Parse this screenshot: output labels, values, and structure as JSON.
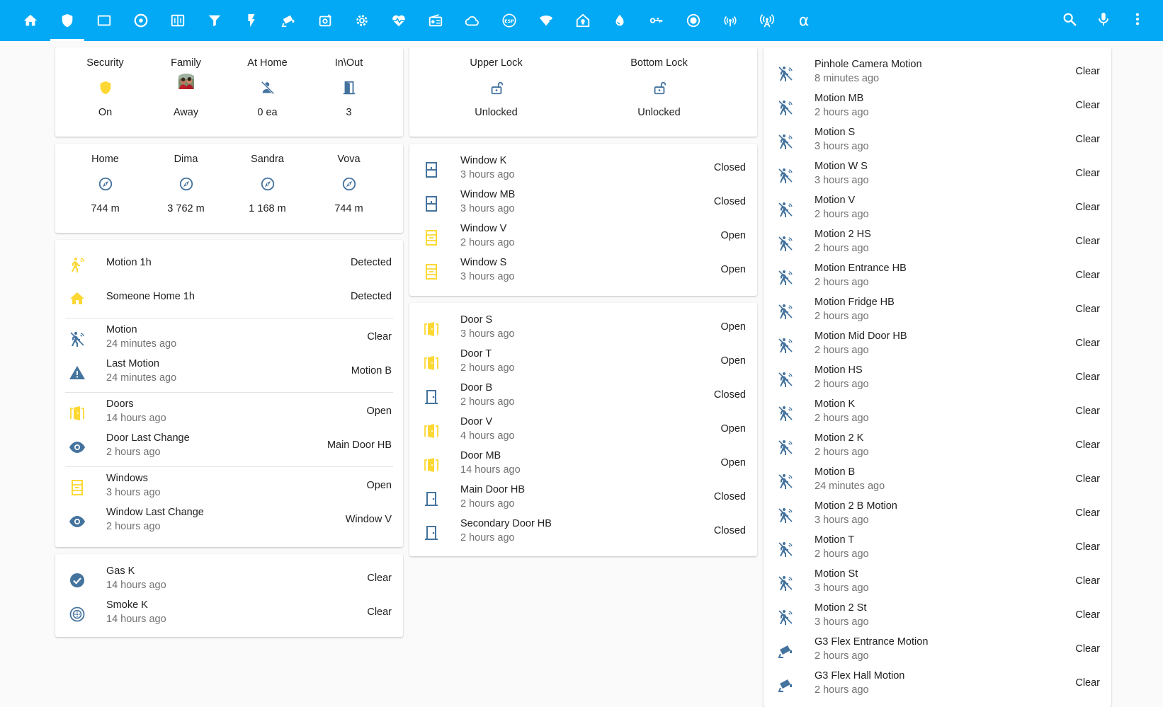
{
  "colors": {
    "header": "#03a9f4",
    "icon_blue": "#44739e",
    "icon_yellow": "#fdd835"
  },
  "toolbar": {
    "tabs": [
      {
        "name": "home"
      },
      {
        "name": "shield"
      },
      {
        "name": "rectangle"
      },
      {
        "name": "disc"
      },
      {
        "name": "panel"
      },
      {
        "name": "filter"
      },
      {
        "name": "flash"
      },
      {
        "name": "cctv"
      },
      {
        "name": "robot"
      },
      {
        "name": "settings"
      },
      {
        "name": "heart-pulse"
      },
      {
        "name": "radio"
      },
      {
        "name": "cloud"
      },
      {
        "name": "esp"
      },
      {
        "name": "wifi-alert"
      },
      {
        "name": "home-lightbulb"
      },
      {
        "name": "water"
      },
      {
        "name": "mdi-key"
      },
      {
        "name": "record"
      },
      {
        "name": "access-point"
      },
      {
        "name": "antenna"
      },
      {
        "name": "alpha",
        "glyph": "α"
      }
    ],
    "search_icon": "magnify-icon",
    "mic_icon": "microphone-icon",
    "menu_icon": "dots-vertical-icon"
  },
  "status_glance": {
    "items": [
      {
        "name": "Security",
        "state": "On",
        "icon": "shield-icon",
        "color": "yellow"
      },
      {
        "name": "Family",
        "state": "Away",
        "icon": "avatar"
      },
      {
        "name": "At Home",
        "state": "0 ea",
        "icon": "account-off-icon",
        "color": "blue"
      },
      {
        "name": "In\\Out",
        "state": "3",
        "icon": "door-icon",
        "color": "blue"
      }
    ]
  },
  "location_glance": {
    "items": [
      {
        "name": "Home",
        "state": "744 m",
        "icon": "compass-icon"
      },
      {
        "name": "Dima",
        "state": "3 762 m",
        "icon": "compass-icon"
      },
      {
        "name": "Sandra",
        "state": "1 168 m",
        "icon": "compass-icon"
      },
      {
        "name": "Vova",
        "state": "744 m",
        "icon": "compass-icon"
      }
    ]
  },
  "summary": {
    "groups": [
      [
        {
          "name": "Motion 1h",
          "secondary": "",
          "state": "Detected",
          "icon": "motion-active",
          "color": "yellow"
        },
        {
          "name": "Someone Home 1h",
          "secondary": "",
          "state": "Detected",
          "icon": "home",
          "color": "yellow"
        }
      ],
      [
        {
          "name": "Motion",
          "secondary": "24 minutes ago",
          "state": "Clear",
          "icon": "motion-off",
          "color": "blue"
        },
        {
          "name": "Last Motion",
          "secondary": "24 minutes ago",
          "state": "Motion B",
          "icon": "alert",
          "color": "blue"
        }
      ],
      [
        {
          "name": "Doors",
          "secondary": "14 hours ago",
          "state": "Open",
          "icon": "door-open",
          "color": "yellow"
        },
        {
          "name": "Door Last Change",
          "secondary": "2 hours ago",
          "state": "Main Door HB",
          "icon": "eye",
          "color": "blue"
        }
      ],
      [
        {
          "name": "Windows",
          "secondary": "3 hours ago",
          "state": "Open",
          "icon": "window-open",
          "color": "yellow"
        },
        {
          "name": "Window Last Change",
          "secondary": "2 hours ago",
          "state": "Window V",
          "icon": "eye",
          "color": "blue"
        }
      ]
    ]
  },
  "safety": {
    "rows": [
      {
        "name": "Gas K",
        "secondary": "14 hours ago",
        "state": "Clear",
        "icon": "check-circle",
        "color": "blue"
      },
      {
        "name": "Smoke K",
        "secondary": "14 hours ago",
        "state": "Clear",
        "icon": "smoke-detector",
        "color": "blue"
      }
    ]
  },
  "locks": {
    "items": [
      {
        "name": "Upper Lock",
        "state": "Unlocked",
        "icon": "lock-open-icon"
      },
      {
        "name": "Bottom Lock",
        "state": "Unlocked",
        "icon": "lock-open-icon"
      }
    ]
  },
  "windows": {
    "rows": [
      {
        "name": "Window K",
        "secondary": "3 hours ago",
        "state": "Closed",
        "icon": "window-closed",
        "color": "blue"
      },
      {
        "name": "Window MB",
        "secondary": "3 hours ago",
        "state": "Closed",
        "icon": "window-closed",
        "color": "blue"
      },
      {
        "name": "Window V",
        "secondary": "2 hours ago",
        "state": "Open",
        "icon": "window-open",
        "color": "yellow"
      },
      {
        "name": "Window S",
        "secondary": "3 hours ago",
        "state": "Open",
        "icon": "window-open",
        "color": "yellow"
      }
    ]
  },
  "doors": {
    "rows": [
      {
        "name": "Door S",
        "secondary": "3 hours ago",
        "state": "Open",
        "icon": "door-open",
        "color": "yellow"
      },
      {
        "name": "Door T",
        "secondary": "2 hours ago",
        "state": "Open",
        "icon": "door-open",
        "color": "yellow"
      },
      {
        "name": "Door B",
        "secondary": "2 hours ago",
        "state": "Closed",
        "icon": "door-closed",
        "color": "blue"
      },
      {
        "name": "Door V",
        "secondary": "4 hours ago",
        "state": "Open",
        "icon": "door-open",
        "color": "yellow"
      },
      {
        "name": "Door MB",
        "secondary": "14 hours ago",
        "state": "Open",
        "icon": "door-open",
        "color": "yellow"
      },
      {
        "name": "Main Door HB",
        "secondary": "2 hours ago",
        "state": "Closed",
        "icon": "door-closed",
        "color": "blue"
      },
      {
        "name": "Secondary Door HB",
        "secondary": "2 hours ago",
        "state": "Closed",
        "icon": "door-closed",
        "color": "blue"
      }
    ]
  },
  "motions": {
    "rows": [
      {
        "name": "Pinhole Camera Motion",
        "secondary": "8 minutes ago",
        "state": "Clear",
        "icon": "motion-off"
      },
      {
        "name": "Motion MB",
        "secondary": "2 hours ago",
        "state": "Clear",
        "icon": "motion-off"
      },
      {
        "name": "Motion S",
        "secondary": "3 hours ago",
        "state": "Clear",
        "icon": "motion-off"
      },
      {
        "name": "Motion W S",
        "secondary": "3 hours ago",
        "state": "Clear",
        "icon": "motion-off"
      },
      {
        "name": "Motion V",
        "secondary": "2 hours ago",
        "state": "Clear",
        "icon": "motion-off"
      },
      {
        "name": "Motion 2 HS",
        "secondary": "2 hours ago",
        "state": "Clear",
        "icon": "motion-off"
      },
      {
        "name": "Motion Entrance HB",
        "secondary": "2 hours ago",
        "state": "Clear",
        "icon": "motion-off"
      },
      {
        "name": "Motion Fridge HB",
        "secondary": "2 hours ago",
        "state": "Clear",
        "icon": "motion-off"
      },
      {
        "name": "Motion Mid Door HB",
        "secondary": "2 hours ago",
        "state": "Clear",
        "icon": "motion-off"
      },
      {
        "name": "Motion HS",
        "secondary": "2 hours ago",
        "state": "Clear",
        "icon": "motion-off"
      },
      {
        "name": "Motion K",
        "secondary": "2 hours ago",
        "state": "Clear",
        "icon": "motion-off"
      },
      {
        "name": "Motion 2 K",
        "secondary": "2 hours ago",
        "state": "Clear",
        "icon": "motion-off"
      },
      {
        "name": "Motion B",
        "secondary": "24 minutes ago",
        "state": "Clear",
        "icon": "motion-off"
      },
      {
        "name": "Motion 2 B Motion",
        "secondary": "3 hours ago",
        "state": "Clear",
        "icon": "motion-off"
      },
      {
        "name": "Motion T",
        "secondary": "2 hours ago",
        "state": "Clear",
        "icon": "motion-off"
      },
      {
        "name": "Motion St",
        "secondary": "3 hours ago",
        "state": "Clear",
        "icon": "motion-off"
      },
      {
        "name": "Motion 2 St",
        "secondary": "3 hours ago",
        "state": "Clear",
        "icon": "motion-off"
      },
      {
        "name": "G3 Flex Entrance Motion",
        "secondary": "2 hours ago",
        "state": "Clear",
        "icon": "cctv"
      },
      {
        "name": "G3 Flex Hall Motion",
        "secondary": "2 hours ago",
        "state": "Clear",
        "icon": "cctv"
      }
    ]
  }
}
